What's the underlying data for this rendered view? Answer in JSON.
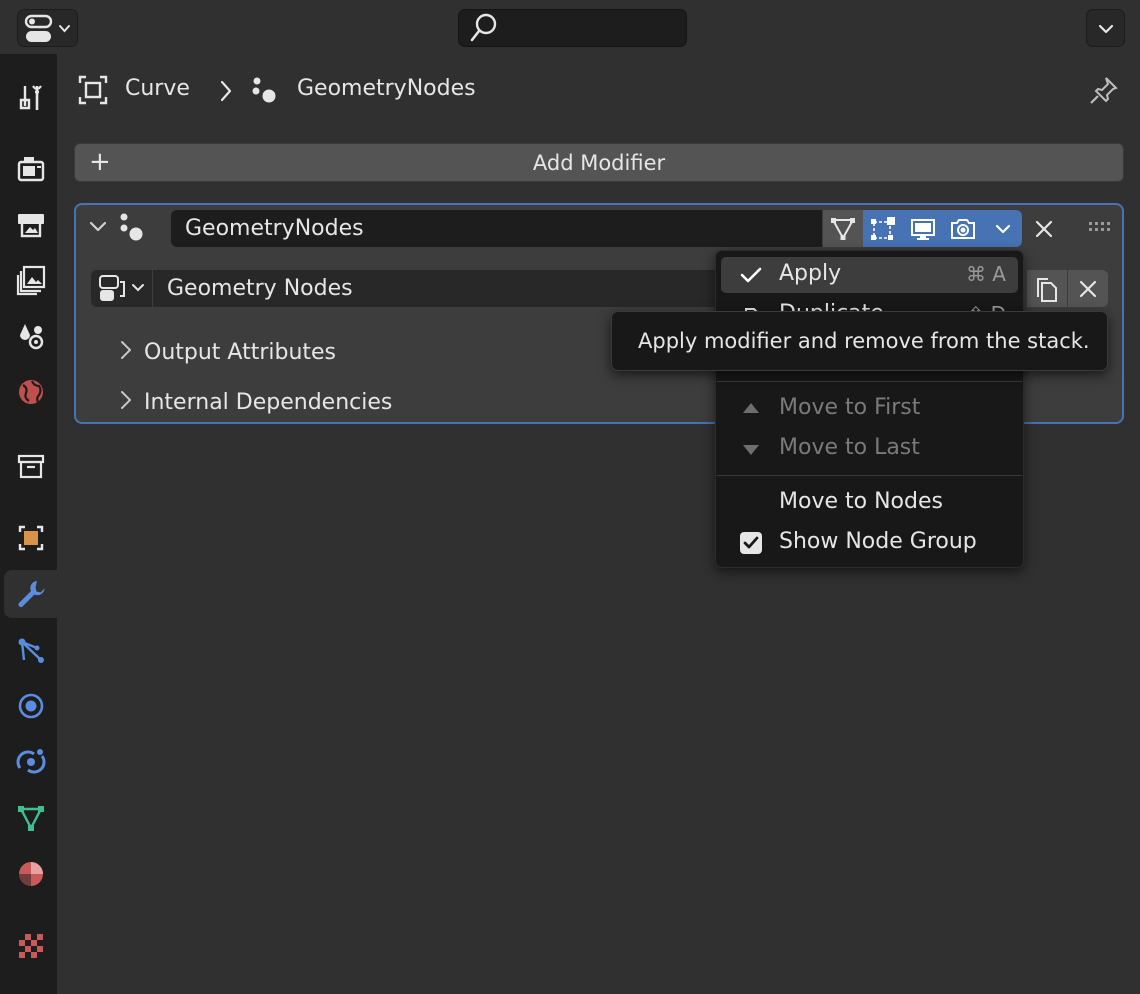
{
  "colors": {
    "accent": "#4772b3",
    "background": "#303030",
    "sidebar": "#1d1d1d",
    "panel": "#3d3d3d",
    "menu": "#181818"
  },
  "header": {
    "editor_type_icon": "properties-editor-icon",
    "search_icon": "search-icon",
    "menu_icon": "chevron-down-icon"
  },
  "sidebar": {
    "tabs": [
      {
        "name": "tool",
        "icon": "tool-icon",
        "active": false
      },
      {
        "name": "render",
        "icon": "render-icon",
        "active": false
      },
      {
        "name": "output",
        "icon": "output-icon",
        "active": false
      },
      {
        "name": "view-layer",
        "icon": "view-layer-icon",
        "active": false
      },
      {
        "name": "scene",
        "icon": "scene-icon",
        "active": false
      },
      {
        "name": "world",
        "icon": "world-icon",
        "active": false
      },
      {
        "name": "collection",
        "icon": "collection-icon",
        "active": false
      },
      {
        "name": "object",
        "icon": "object-icon",
        "active": false
      },
      {
        "name": "modifiers",
        "icon": "wrench-icon",
        "active": true
      },
      {
        "name": "particles",
        "icon": "particles-icon",
        "active": false
      },
      {
        "name": "physics",
        "icon": "physics-icon",
        "active": false
      },
      {
        "name": "constraints",
        "icon": "constraints-icon",
        "active": false
      },
      {
        "name": "data",
        "icon": "curve-data-icon",
        "active": false
      },
      {
        "name": "material",
        "icon": "material-icon",
        "active": false
      },
      {
        "name": "texture",
        "icon": "texture-icon",
        "active": false
      }
    ]
  },
  "breadcrumb": {
    "object": "Curve",
    "modifier": "GeometryNodes"
  },
  "add_modifier": {
    "plus": "+",
    "label": "Add Modifier"
  },
  "modifier": {
    "name": "GeometryNodes",
    "node_group": "Geometry Nodes",
    "toggles": {
      "edit_mode": false,
      "on_cage": true,
      "viewport": true,
      "render": true
    },
    "subpanels": [
      "Output Attributes",
      "Internal Dependencies"
    ]
  },
  "dropdown": {
    "items": [
      {
        "label": "Apply",
        "shortcut": "⌘ A",
        "icon": "checkmark-icon",
        "highlighted": true,
        "disabled": false
      },
      {
        "label": "Duplicate",
        "shortcut": "⇧ D",
        "icon": "duplicate-icon",
        "highlighted": false,
        "disabled": false,
        "partially_hidden": true
      },
      {
        "label": "Move to First",
        "icon": "triangle-up-icon",
        "disabled": true
      },
      {
        "label": "Move to Last",
        "icon": "triangle-down-icon",
        "disabled": true
      },
      {
        "label": "Move to Nodes",
        "disabled": false
      },
      {
        "label": "Show Node Group",
        "icon": "checkbox-icon",
        "checked": true,
        "disabled": false
      }
    ]
  },
  "tooltip": {
    "text": "Apply modifier and remove from the stack."
  }
}
